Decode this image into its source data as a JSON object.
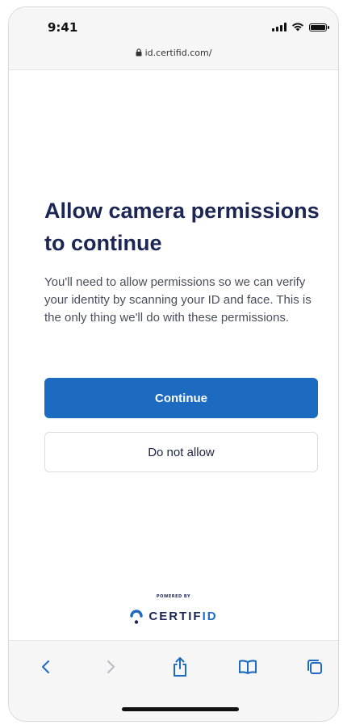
{
  "status_bar": {
    "time": "9:41"
  },
  "address_bar": {
    "url": "id.certifid.com/"
  },
  "content": {
    "title": "Allow camera permissions to continue",
    "description": "You'll need to allow permissions so we can verify your identity by scanning your ID and face. This is the only thing we'll do with these permissions.",
    "continue_label": "Continue",
    "deny_label": "Do not allow"
  },
  "branding": {
    "powered_by": "POWERED BY",
    "name_main": "CERTIF",
    "name_accent": "ID"
  },
  "toolbar": {
    "icons": [
      "back-icon",
      "forward-icon",
      "share-icon",
      "bookmarks-icon",
      "tabs-icon"
    ]
  },
  "colors": {
    "primary": "#1c6bc0",
    "title": "#1b2654",
    "body_text": "#4a4f5c",
    "toolbar_bg": "#f6f6f7"
  }
}
